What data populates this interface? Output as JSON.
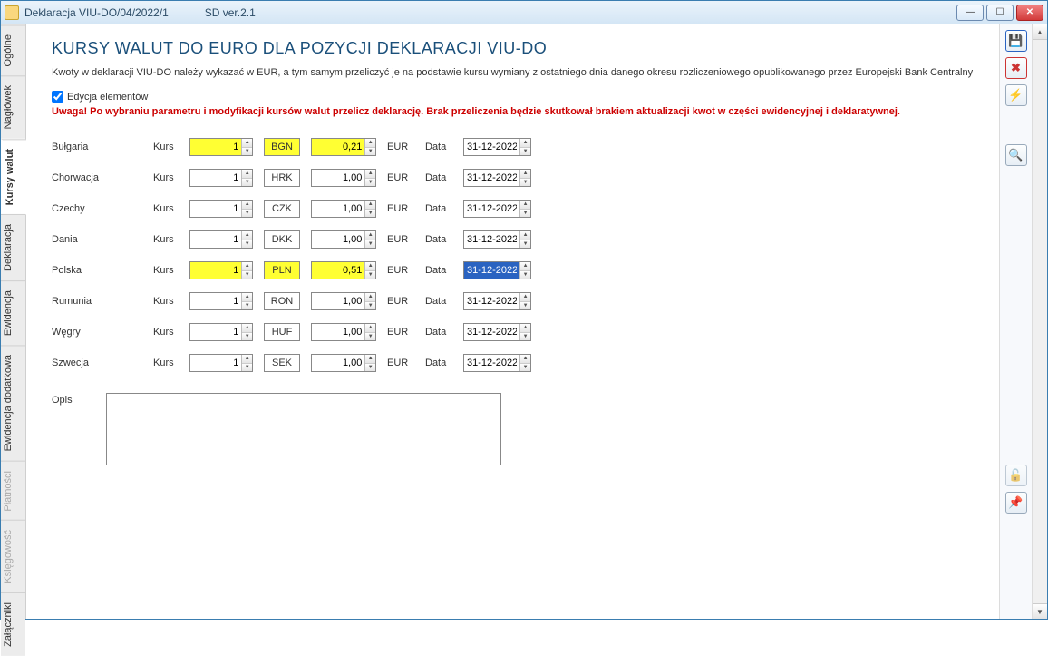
{
  "window": {
    "title_main": "Deklaracja VIU-DO/04/2022/1",
    "title_ver": "SD ver.2.1"
  },
  "tabs": [
    {
      "label": "Ogólne",
      "disabled": false,
      "active": false
    },
    {
      "label": "Nagłówek",
      "disabled": false,
      "active": false
    },
    {
      "label": "Kursy walut",
      "disabled": false,
      "active": true
    },
    {
      "label": "Deklaracja",
      "disabled": false,
      "active": false
    },
    {
      "label": "Ewidencja",
      "disabled": false,
      "active": false
    },
    {
      "label": "Ewidencja dodatkowa",
      "disabled": false,
      "active": false
    },
    {
      "label": "Płatności",
      "disabled": true,
      "active": false
    },
    {
      "label": "Księgowość",
      "disabled": true,
      "active": false
    },
    {
      "label": "Załączniki",
      "disabled": false,
      "active": false
    }
  ],
  "page": {
    "title": "KURSY WALUT DO EURO DLA POZYCJI DEKLARACJI VIU-DO",
    "subtitle": "Kwoty w deklaracji VIU-DO należy wykazać w EUR, a tym samym przeliczyć je na podstawie kursu wymiany z ostatniego dnia danego okresu rozliczeniowego opublikowanego przez Europejski Bank Centralny",
    "checkbox_label": "Edycja elementów",
    "checkbox_checked": true,
    "warning": "Uwaga! Po wybraniu parametru i modyfikacji kursów walut przelicz deklarację. Brak przeliczenia będzie skutkował brakiem aktualizacji kwot w części ewidencyjnej i deklaratywnej."
  },
  "labels": {
    "kurs": "Kurs",
    "eur": "EUR",
    "data": "Data",
    "opis": "Opis"
  },
  "rows": [
    {
      "country": "Bułgaria",
      "qty": "1",
      "ccy": "BGN",
      "rate": "0,21",
      "date": "31-12-2022",
      "highlight": true,
      "date_selected": false
    },
    {
      "country": "Chorwacja",
      "qty": "1",
      "ccy": "HRK",
      "rate": "1,00",
      "date": "31-12-2022",
      "highlight": false,
      "date_selected": false
    },
    {
      "country": "Czechy",
      "qty": "1",
      "ccy": "CZK",
      "rate": "1,00",
      "date": "31-12-2022",
      "highlight": false,
      "date_selected": false
    },
    {
      "country": "Dania",
      "qty": "1",
      "ccy": "DKK",
      "rate": "1,00",
      "date": "31-12-2022",
      "highlight": false,
      "date_selected": false
    },
    {
      "country": "Polska",
      "qty": "1",
      "ccy": "PLN",
      "rate": "0,51",
      "date": "31-12-2022",
      "highlight": true,
      "date_selected": true
    },
    {
      "country": "Rumunia",
      "qty": "1",
      "ccy": "RON",
      "rate": "1,00",
      "date": "31-12-2022",
      "highlight": false,
      "date_selected": false
    },
    {
      "country": "Węgry",
      "qty": "1",
      "ccy": "HUF",
      "rate": "1,00",
      "date": "31-12-2022",
      "highlight": false,
      "date_selected": false
    },
    {
      "country": "Szwecja",
      "qty": "1",
      "ccy": "SEK",
      "rate": "1,00",
      "date": "31-12-2022",
      "highlight": false,
      "date_selected": false
    }
  ],
  "opis": "",
  "icons": {
    "save": "💾",
    "delete": "✖",
    "lightning": "⚡",
    "zoom": "🔍",
    "lock": "🔓",
    "pin": "📌",
    "min": "—",
    "max": "☐",
    "close": "✕",
    "up": "▲",
    "down": "▼"
  }
}
